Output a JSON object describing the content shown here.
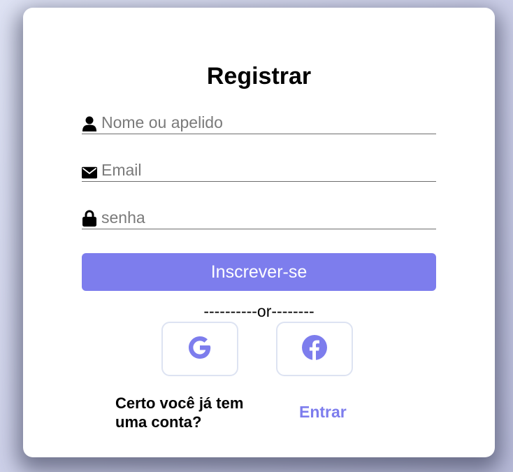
{
  "form": {
    "title": "Registrar",
    "fields": [
      {
        "icon": "user-icon",
        "placeholder": "Nome ou apelido",
        "type": "text",
        "value": ""
      },
      {
        "icon": "envelope-icon",
        "placeholder": "Email",
        "type": "email",
        "value": ""
      },
      {
        "icon": "lock-icon",
        "placeholder": "senha",
        "type": "password",
        "value": ""
      }
    ],
    "submit_label": "Inscrever-se",
    "divider_text": "----------or--------",
    "social": [
      {
        "icon": "google-icon"
      },
      {
        "icon": "facebook-icon"
      }
    ],
    "account_question": "Certo você já tem uma conta?",
    "login_label": "Entrar"
  },
  "colors": {
    "accent": "#7d7ded",
    "card_background": "#ffffff",
    "social_border": "#dde3f2",
    "page_background": "#c9cce6"
  }
}
